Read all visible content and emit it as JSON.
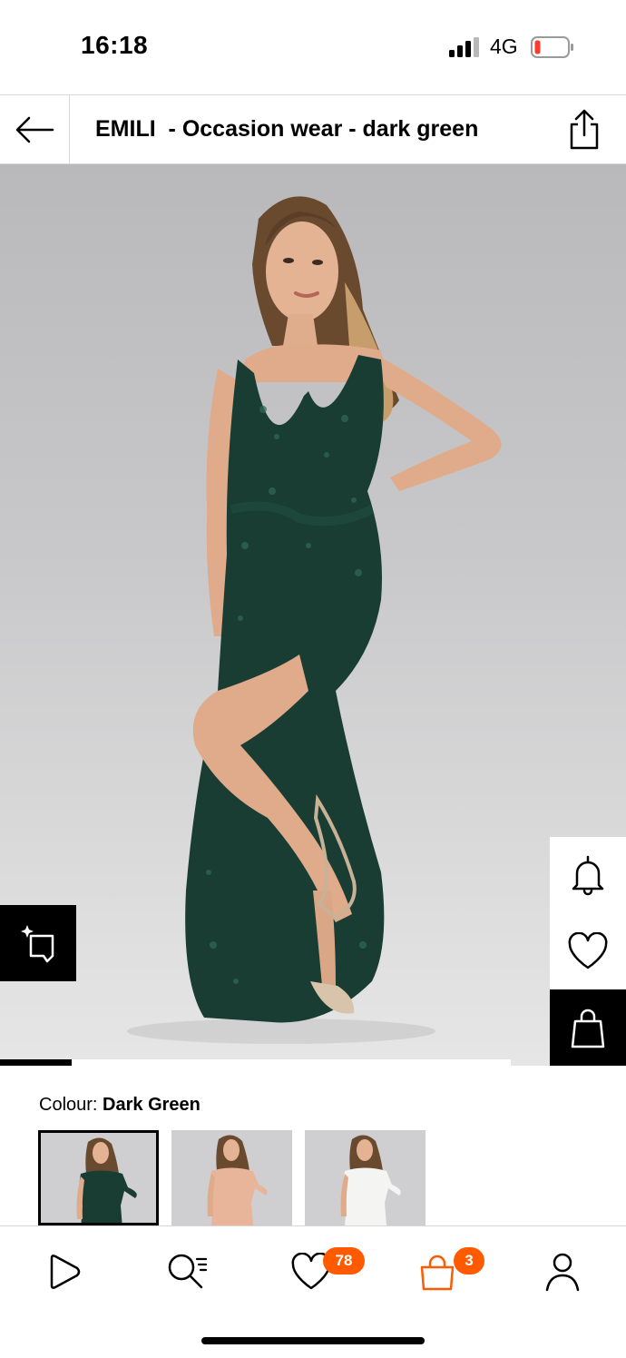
{
  "status_bar": {
    "time": "16:18",
    "network": "4G"
  },
  "header": {
    "title": "EMILI  - Occasion wear - dark green"
  },
  "gallery": {
    "progress_fraction": 0.14
  },
  "colour": {
    "label": "Colour:",
    "value": "Dark Green"
  },
  "thumbnails": [
    {
      "dress_color": "#1a3d33",
      "selected": true
    },
    {
      "dress_color": "#e8b59a",
      "selected": false
    },
    {
      "dress_color": "#f4f4f2",
      "selected": false
    }
  ],
  "bottom_nav": {
    "wishlist_count": "78",
    "bag_count": "3"
  },
  "colors": {
    "accent": "#ff5a00",
    "battery_low": "#ff3b30"
  }
}
